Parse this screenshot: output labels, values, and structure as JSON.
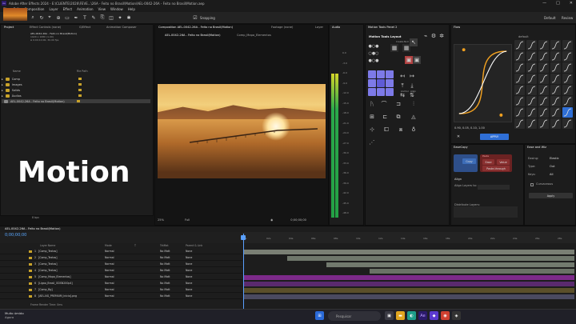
{
  "window": {
    "title": "Adobe After Effects 2024 - E:\\CLIENTE\\2026\\FEVE...\\26A - Feito no Brasil\\Motion\\AEL-0042-26A - Feito no Brasil\\Motion.aep",
    "controls": [
      "—",
      "□",
      "✕"
    ]
  },
  "menu": [
    "File",
    "Edit",
    "Composition",
    "Layer",
    "Effect",
    "Animation",
    "View",
    "Window",
    "Help"
  ],
  "toolbar": {
    "snapping": "Snapping",
    "workspaces": [
      "Default",
      "Review",
      "Learn"
    ]
  },
  "project": {
    "tabs": [
      "Project",
      "Effect Controls (none)",
      "G/Effect",
      "Animation Composer"
    ],
    "item_name": "AEL-0042-26A - Feito no Brasil(Motion)",
    "item_info": [
      "1920 x 1080 (1.00)",
      "Δ 0;00;10;00, 30.00 fps"
    ],
    "headers": [
      "Name",
      "File Path"
    ],
    "rows": [
      {
        "name": "Comp",
        "color": "#c9a32a"
      },
      {
        "name": "Images",
        "color": "#c9a32a"
      },
      {
        "name": "Solids",
        "color": "#c9a32a"
      },
      {
        "name": "Áudios",
        "color": "#c9a32a"
      },
      {
        "name": "AEL-0042-26A - Feito no Brasil(Motion)",
        "color": "#c9a32a",
        "selected": true
      }
    ],
    "footer": "8 bpc"
  },
  "overlay_text": "Motion",
  "composition": {
    "tabs": [
      "Composition AEL-0042-26A - Feito no Brasil(Motion)",
      "Footage (none)",
      "Layer"
    ],
    "subtabs": [
      "AEL-0042-26A - Feito no Brasil(Motion)",
      "Comp_Mapa_Elementos"
    ],
    "zoom": "25%",
    "resolution": "Full",
    "timecode": "0;00;00;00"
  },
  "audio": {
    "title": "Audio",
    "db_labels": [
      "0.0",
      "-3.0",
      "-6.0",
      "-9.0",
      "-12.0",
      "-15.0",
      "-18.0",
      "-21.0",
      "-24.0",
      "-27.0",
      "-30.0",
      "-33.0",
      "-36.0",
      "-39.0",
      "-42.0",
      "-45.0",
      "-48.0"
    ]
  },
  "motion_tools": {
    "title": "Motion Tools Panel 2",
    "layout_label": "Motion Tools Layout",
    "anchor_labels": [
      "Create Null",
      "Anchor",
      "Align"
    ]
  },
  "flow": {
    "title": "Flow",
    "preset_label": "default",
    "values": "0.90, 0.05, 0.10, 1.00",
    "apply": "APPLY"
  },
  "easecopy": {
    "title": "EaseCopy",
    "copy_label": "Copy",
    "paste_label": "Paste",
    "ease_label": "Ease",
    "value_label": "Value",
    "paste_through": "Paste-through",
    "align_title": "Align",
    "align_layers": "Align Layers to:",
    "distribute": "Distribute Layers:"
  },
  "easewiz": {
    "title": "Ease and Wiz",
    "easing_label": "Easing:",
    "easing_value": "Elastic",
    "type_label": "Type:",
    "type_value": "Out",
    "keys_label": "Keys:",
    "keys_value": "All",
    "curvaceous": "Curvaceous",
    "apply": "Apply"
  },
  "timeline": {
    "tab": "AEL-0042-26A - Feito no Brasil(Motion)",
    "timecode": "0;00;00;00",
    "headers": [
      "Layer Name",
      "Mode",
      "T",
      "TrkMat",
      "Parent & Link"
    ],
    "layers": [
      {
        "num": "1",
        "name": "[Comp_Textos]",
        "mode": "Normal",
        "trk": "No Matt",
        "parent": "None",
        "label": "#c9a32a",
        "bar": "#7a7f74",
        "start": 0.0,
        "end": 1.0
      },
      {
        "num": "2",
        "name": "[Comp_Textos]",
        "mode": "Normal",
        "trk": "No Matt",
        "parent": "None",
        "label": "#c9a32a",
        "bar": "#6f776b",
        "start": 0.13,
        "end": 1.0
      },
      {
        "num": "3",
        "name": "[Comp_Textos]",
        "mode": "Normal",
        "trk": "No Matt",
        "parent": "None",
        "label": "#c9a32a",
        "bar": "#727a6e",
        "start": 0.25,
        "end": 1.0
      },
      {
        "num": "4",
        "name": "[Comp_Textos]",
        "mode": "Normal",
        "trk": "No Matt",
        "parent": "None",
        "label": "#c9a32a",
        "bar": "#6a7266",
        "start": 0.38,
        "end": 1.0
      },
      {
        "num": "5",
        "name": "[Comp_Mapa_Elementos]",
        "mode": "Normal",
        "trk": "No Matt",
        "parent": "None",
        "label": "#c9a32a",
        "bar": "#7d2a8a",
        "start": 0.0,
        "end": 1.0
      },
      {
        "num": "6",
        "name": "[Ligao_Brasil_ODSN200p4]",
        "mode": "Normal",
        "trk": "No Matt",
        "parent": "None",
        "label": "#c9a32a",
        "bar": "#5a2a6e",
        "start": 0.0,
        "end": 1.0
      },
      {
        "num": "7",
        "name": "[Comp_Bg]",
        "mode": "Normal",
        "trk": "No Matt",
        "parent": "None",
        "label": "#c9a32a",
        "bar": "#5a4f2a",
        "start": 0.0,
        "end": 1.0
      },
      {
        "num": "8",
        "name": "[AEL-NG_PREMIUM_Inicio].png",
        "mode": "Normal",
        "trk": "No Matt",
        "parent": "None",
        "label": "#c9a32a",
        "bar": "#4a4a60",
        "start": 0.0,
        "end": 1.0
      }
    ],
    "ticks": [
      "0s",
      "02s",
      "04s",
      "06s",
      "08s",
      "10s",
      "12s",
      "14s",
      "16s",
      "18s",
      "20s",
      "22s",
      "24s",
      "26s",
      "28s"
    ],
    "footer": "Frame Render Time: 0ms"
  },
  "taskbar": {
    "weather_title": "Muito úmido",
    "weather_sub": "Agora",
    "search": "Pesquisar"
  }
}
